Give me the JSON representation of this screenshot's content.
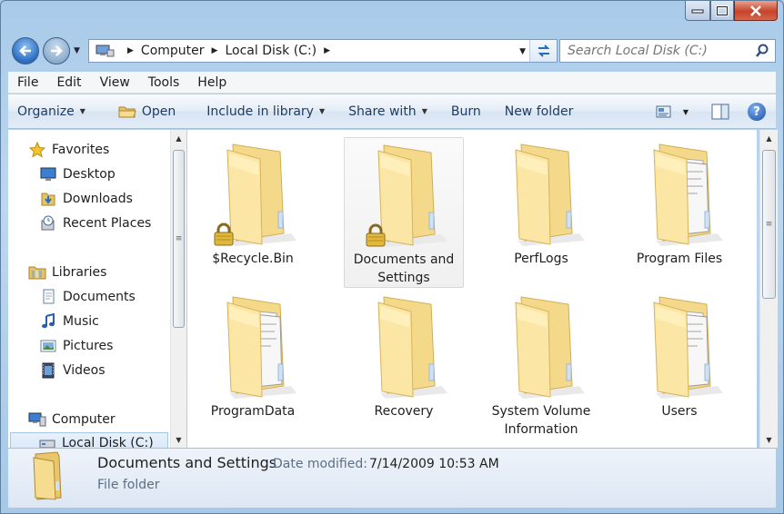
{
  "window": {
    "caption_buttons": {
      "minimize": "▬",
      "maximize": "☐",
      "close": "✕"
    }
  },
  "address_bar": {
    "breadcrumbs": [
      "Computer",
      "Local Disk (C:)"
    ]
  },
  "search": {
    "placeholder": "Search Local Disk (C:)"
  },
  "menu": [
    "File",
    "Edit",
    "View",
    "Tools",
    "Help"
  ],
  "command_bar": {
    "organize": "Organize",
    "open": "Open",
    "include_in_library": "Include in library",
    "share_with": "Share with",
    "burn": "Burn",
    "new_folder": "New folder"
  },
  "sidebar": {
    "favorites": {
      "header": "Favorites",
      "items": [
        "Desktop",
        "Downloads",
        "Recent Places"
      ]
    },
    "libraries": {
      "header": "Libraries",
      "items": [
        "Documents",
        "Music",
        "Pictures",
        "Videos"
      ]
    },
    "computer": {
      "header": "Computer",
      "items": [
        "Local Disk (C:)"
      ]
    }
  },
  "folders": [
    {
      "name": "$Recycle.Bin",
      "locked": true,
      "style": "empty",
      "selected": false
    },
    {
      "name": "Documents and Settings",
      "locked": true,
      "style": "empty",
      "selected": true
    },
    {
      "name": "PerfLogs",
      "locked": false,
      "style": "empty",
      "selected": false
    },
    {
      "name": "Program Files",
      "locked": false,
      "style": "full",
      "selected": false
    },
    {
      "name": "ProgramData",
      "locked": false,
      "style": "full",
      "selected": false
    },
    {
      "name": "Recovery",
      "locked": false,
      "style": "empty",
      "selected": false
    },
    {
      "name": "System Volume Information",
      "locked": false,
      "style": "empty",
      "selected": false
    },
    {
      "name": "Users",
      "locked": false,
      "style": "full",
      "selected": false
    }
  ],
  "details": {
    "name": "Documents and Settings",
    "modified_label": "Date modified:",
    "modified_value": "7/14/2009 10:53 AM",
    "type": "File folder"
  },
  "colors": {
    "frame": "#aacbeb",
    "folder": "#f3d98b",
    "accent": "#2a6cc0"
  }
}
